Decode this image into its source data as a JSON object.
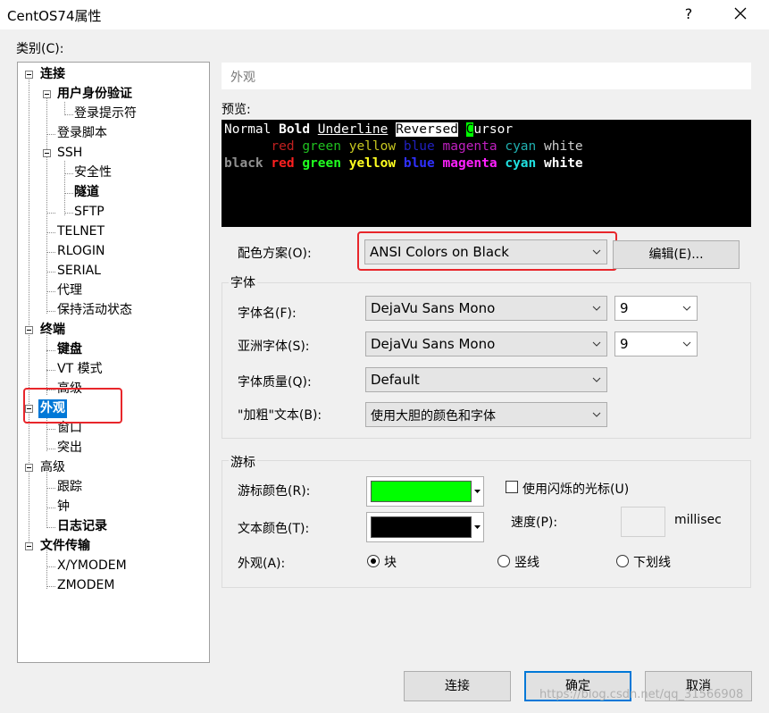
{
  "window": {
    "title": "CentOS74属性",
    "help": "?"
  },
  "category_label": "类别(C):",
  "tree": [
    {
      "label": "连接",
      "bold": true
    },
    {
      "label": "用户身份验证",
      "bold": true
    },
    {
      "label": "登录提示符",
      "bold": false
    },
    {
      "label": "登录脚本",
      "bold": false
    },
    {
      "label": "SSH",
      "bold": false
    },
    {
      "label": "安全性",
      "bold": false
    },
    {
      "label": "隧道",
      "bold": true
    },
    {
      "label": "SFTP",
      "bold": false
    },
    {
      "label": "TELNET",
      "bold": false
    },
    {
      "label": "RLOGIN",
      "bold": false
    },
    {
      "label": "SERIAL",
      "bold": false
    },
    {
      "label": "代理",
      "bold": false
    },
    {
      "label": "保持活动状态",
      "bold": false
    },
    {
      "label": "终端",
      "bold": true
    },
    {
      "label": "键盘",
      "bold": true
    },
    {
      "label": "VT 模式",
      "bold": false
    },
    {
      "label": "高级",
      "bold": false
    },
    {
      "label": "外观",
      "bold": true,
      "selected": true
    },
    {
      "label": "窗口",
      "bold": false
    },
    {
      "label": "突出",
      "bold": false
    },
    {
      "label": "高级",
      "bold": false
    },
    {
      "label": "跟踪",
      "bold": false
    },
    {
      "label": "钟",
      "bold": false
    },
    {
      "label": "日志记录",
      "bold": true
    },
    {
      "label": "文件传输",
      "bold": true
    },
    {
      "label": "X/YMODEM",
      "bold": false
    },
    {
      "label": "ZMODEM",
      "bold": false
    }
  ],
  "section_title": "外观",
  "preview": {
    "label": "预览:",
    "line1": {
      "normal": "Normal",
      "bold": "Bold",
      "underline": "Underline",
      "reversed": "Reversed",
      "cursor_char": "C",
      "cursor_rest": "ursor"
    },
    "colors": {
      "black": "black",
      "red": "red",
      "green": "green",
      "yellow": "yellow",
      "blue": "blue",
      "magenta": "magenta",
      "cyan": "cyan",
      "white": "white"
    }
  },
  "scheme": {
    "label": "配色方案(O):",
    "value": "ANSI Colors on Black",
    "edit_button": "编辑(E)..."
  },
  "font_group": {
    "title": "字体",
    "font_name_label": "字体名(F):",
    "font_name": "DejaVu Sans Mono",
    "font_size": "9",
    "asian_font_label": "亚洲字体(S):",
    "asian_font": "DejaVu Sans Mono",
    "asian_size": "9",
    "quality_label": "字体质量(Q):",
    "quality": "Default",
    "bold_label": "\"加粗\"文本(B):",
    "bold_value": "使用大胆的颜色和字体"
  },
  "cursor_group": {
    "title": "游标",
    "cursor_color_label": "游标颜色(R):",
    "cursor_color": "#00ff00",
    "text_color_label": "文本颜色(T):",
    "text_color": "#000000",
    "blink_label": "使用闪烁的光标(U)",
    "blink_checked": false,
    "speed_label": "速度(P):",
    "speed_value": "",
    "speed_unit": "millisec",
    "style_label": "外观(A):",
    "style_options": [
      {
        "label": "块",
        "checked": true
      },
      {
        "label": "竖线",
        "checked": false
      },
      {
        "label": "下划线",
        "checked": false
      }
    ]
  },
  "buttons": {
    "connect": "连接",
    "ok": "确定",
    "cancel": "取消"
  },
  "watermark": "https://blog.csdn.net/qq_31566908"
}
